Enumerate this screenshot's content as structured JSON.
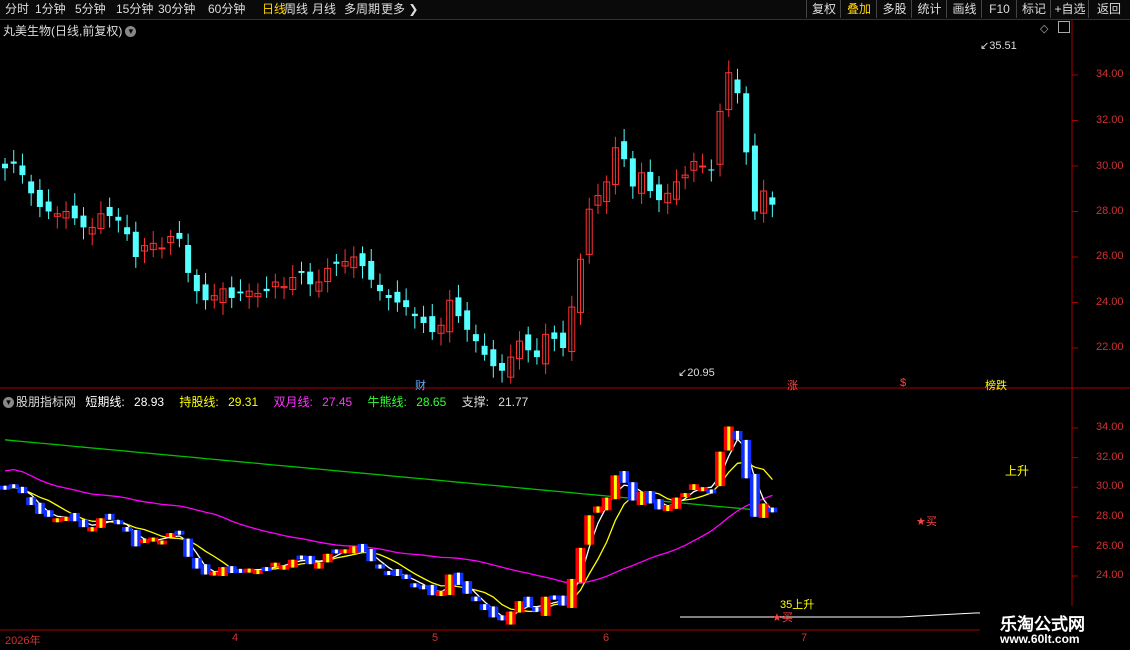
{
  "toolbar": {
    "periods": [
      "分时",
      "1分钟",
      "5分钟",
      "15分钟",
      "30分钟",
      "60分钟",
      "日线",
      "周线",
      "月线",
      "多周期",
      "更多"
    ],
    "active_period": "日线",
    "right_buttons": [
      "复权",
      "叠加",
      "多股",
      "统计",
      "画线",
      "F10",
      "标记",
      "+自选",
      "返回"
    ],
    "active_right": "叠加"
  },
  "main_chart": {
    "title": "丸美生物(日线,前复权)",
    "high_label": "35.51",
    "low_label": "20.95",
    "y_ticks": [
      "34.00",
      "32.00",
      "30.00",
      "28.00",
      "26.00",
      "24.00",
      "22.00"
    ],
    "markers": [
      "财",
      "涨",
      "$",
      "榜跌"
    ]
  },
  "indicator": {
    "name": "股朋指标网",
    "short_label": "短期线:",
    "short_value": "28.93",
    "hold_label": "持股线:",
    "hold_value": "29.31",
    "double_label": "双月线:",
    "double_value": "27.45",
    "bull_label": "牛熊线:",
    "bull_value": "28.65",
    "support_label": "支撑:",
    "support_value": "21.77",
    "y_ticks": [
      "34.00",
      "32.00",
      "30.00",
      "28.00",
      "26.00",
      "24.00"
    ],
    "signals": [
      "买",
      "35上升",
      "买",
      "上升"
    ]
  },
  "x_axis": [
    "2026年",
    "4",
    "5",
    "6",
    "7"
  ],
  "watermark": {
    "title": "乐淘公式网",
    "url": "www.60lt.com"
  },
  "colors": {
    "up": "#ff3232",
    "down": "#54ffff",
    "short": "#ffffff",
    "hold": "#ffff00",
    "double": "#ff00ff",
    "bull": "#00c000"
  },
  "chart_data": {
    "type": "candlestick",
    "price_range": [
      20.95,
      35.51
    ],
    "closes": [
      29.9,
      30.1,
      29.6,
      28.8,
      28.2,
      28.0,
      27.9,
      28.0,
      27.7,
      27.3,
      27.3,
      27.9,
      27.8,
      27.6,
      27.0,
      26.0,
      26.5,
      26.6,
      26.4,
      26.9,
      26.8,
      25.3,
      24.5,
      24.1,
      24.3,
      24.6,
      24.2,
      24.4,
      24.5,
      24.4,
      24.5,
      24.9,
      24.7,
      25.1,
      25.3,
      24.8,
      24.9,
      25.5,
      25.7,
      25.8,
      26.0,
      25.6,
      25.0,
      24.5,
      24.2,
      24.0,
      23.8,
      23.4,
      23.1,
      22.7,
      23.0,
      24.1,
      23.4,
      22.8,
      22.3,
      21.7,
      21.2,
      21.0,
      21.6,
      22.3,
      21.9,
      21.6,
      22.6,
      22.4,
      22.0,
      23.8,
      25.9,
      28.1,
      28.7,
      29.3,
      30.8,
      30.3,
      29.1,
      29.7,
      28.9,
      28.5,
      28.8,
      29.3,
      29.6,
      30.2,
      30.0,
      29.8,
      32.4,
      34.1,
      33.2,
      30.6,
      28.0,
      28.9,
      28.3
    ]
  }
}
